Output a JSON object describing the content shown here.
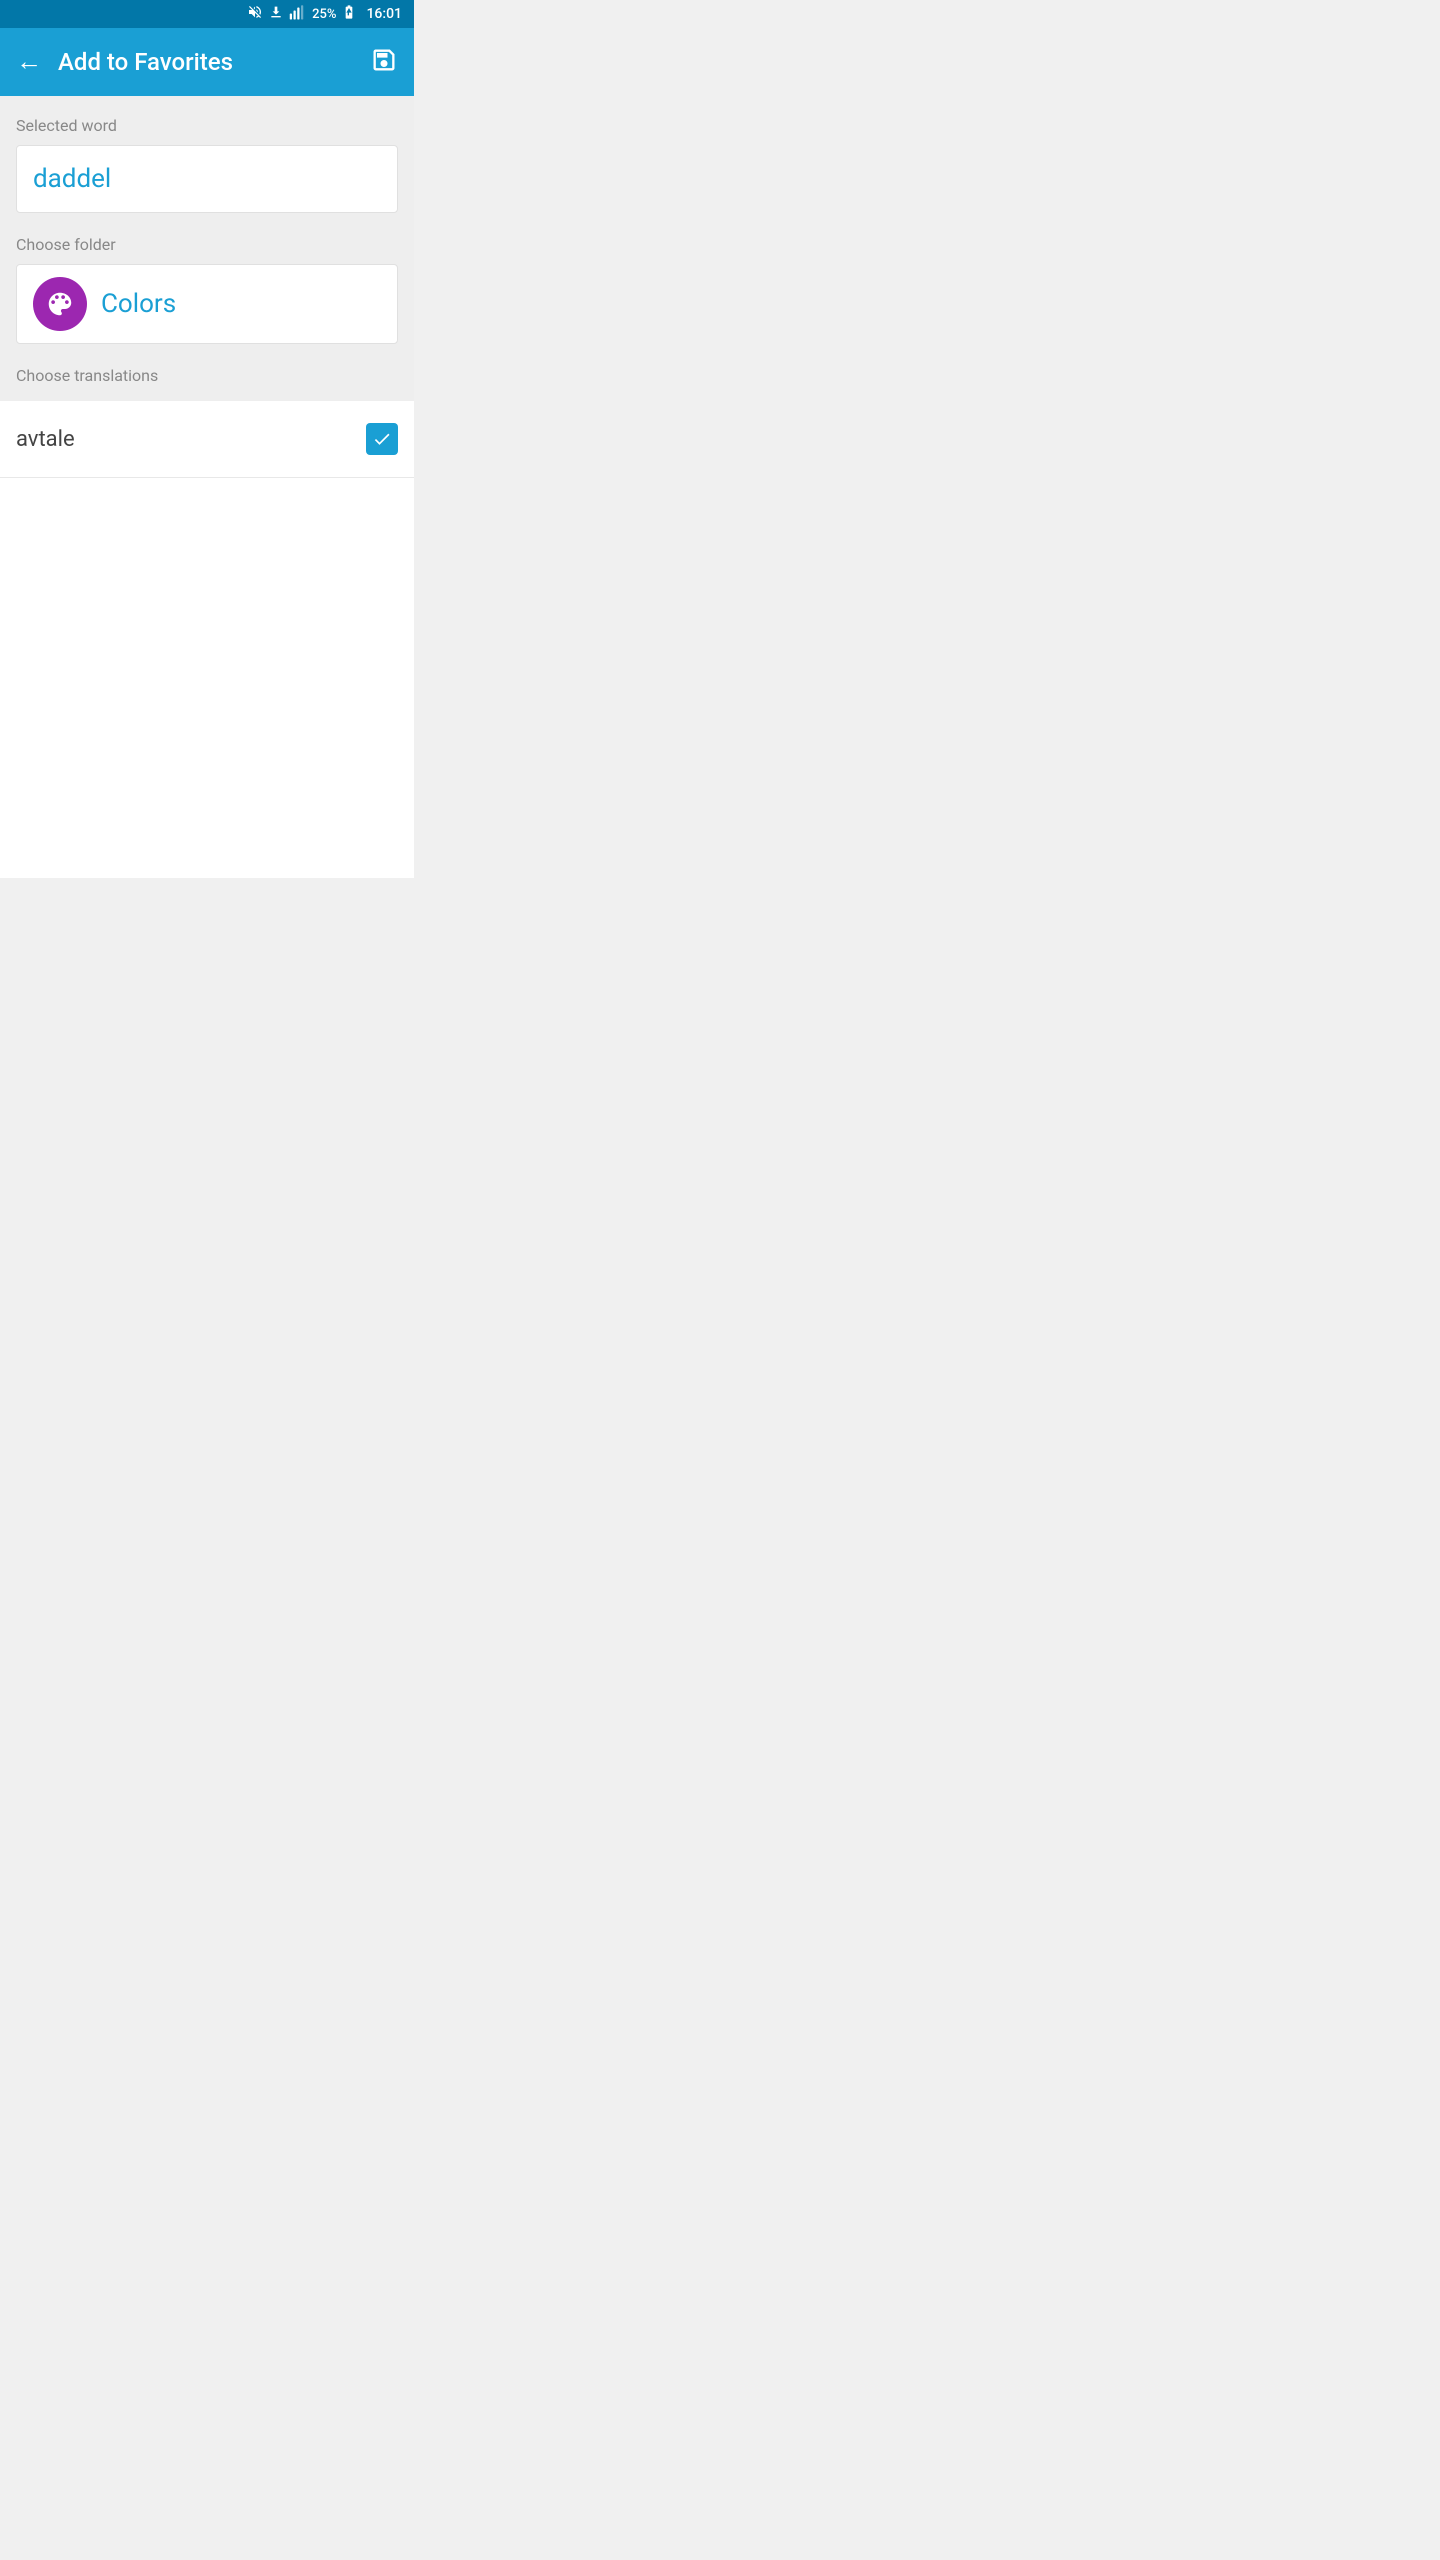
{
  "statusBar": {
    "battery": "25%",
    "time": "16:01"
  },
  "appBar": {
    "title": "Add to Favorites",
    "backArrow": "←",
    "saveIconLabel": "save"
  },
  "selectedWord": {
    "label": "Selected word",
    "value": "daddel"
  },
  "chooseFolder": {
    "label": "Choose folder",
    "folderName": "Colors",
    "folderIconLabel": "palette-icon"
  },
  "chooseTranslations": {
    "label": "Choose translations",
    "items": [
      {
        "word": "avtale",
        "checked": true
      }
    ]
  }
}
